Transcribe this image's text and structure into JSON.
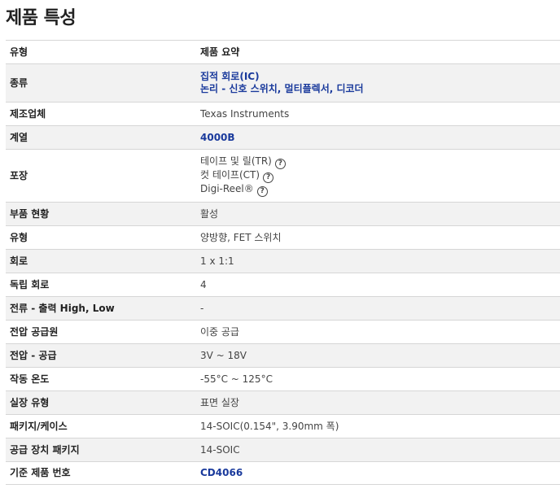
{
  "page_title": "제품 특성",
  "header": {
    "attr": "유형",
    "value": "제품 요약"
  },
  "rows": [
    {
      "label": "종류",
      "lines": [
        "집적 회로(IC)",
        "논리 - 신호 스위치, 멀티플렉서, 디코더"
      ]
    },
    {
      "label": "제조업체",
      "value": "Texas Instruments"
    },
    {
      "label": "계열",
      "value": "4000B"
    },
    {
      "label": "포장",
      "lines": [
        "테이프 및 릴(TR)",
        "컷 테이프(CT)",
        "Digi-Reel®"
      ]
    },
    {
      "label": "부품 현황",
      "value": "활성"
    },
    {
      "label": "유형",
      "value": "양방향, FET 스위치"
    },
    {
      "label": "회로",
      "value": "1 x 1:1"
    },
    {
      "label": "독립 회로",
      "value": "4"
    },
    {
      "label": "전류 - 출력 High, Low",
      "value": "-"
    },
    {
      "label": "전압 공급원",
      "value": "이중 공급"
    },
    {
      "label": "전압 - 공급",
      "value": "3V ~ 18V"
    },
    {
      "label": "작동 온도",
      "value": "-55°C ~ 125°C"
    },
    {
      "label": "실장 유형",
      "value": "표면 실장"
    },
    {
      "label": "패키지/케이스",
      "value": "14-SOIC(0.154\", 3.90mm 폭)"
    },
    {
      "label": "공급 장치 패키지",
      "value": "14-SOIC"
    },
    {
      "label": "기준 제품 번호",
      "value": "CD4066"
    }
  ],
  "help_icon_glyph": "?",
  "colors": {
    "link": "#1a3a9c",
    "stripe": "#f2f2f2",
    "border": "#d6d6d6"
  }
}
